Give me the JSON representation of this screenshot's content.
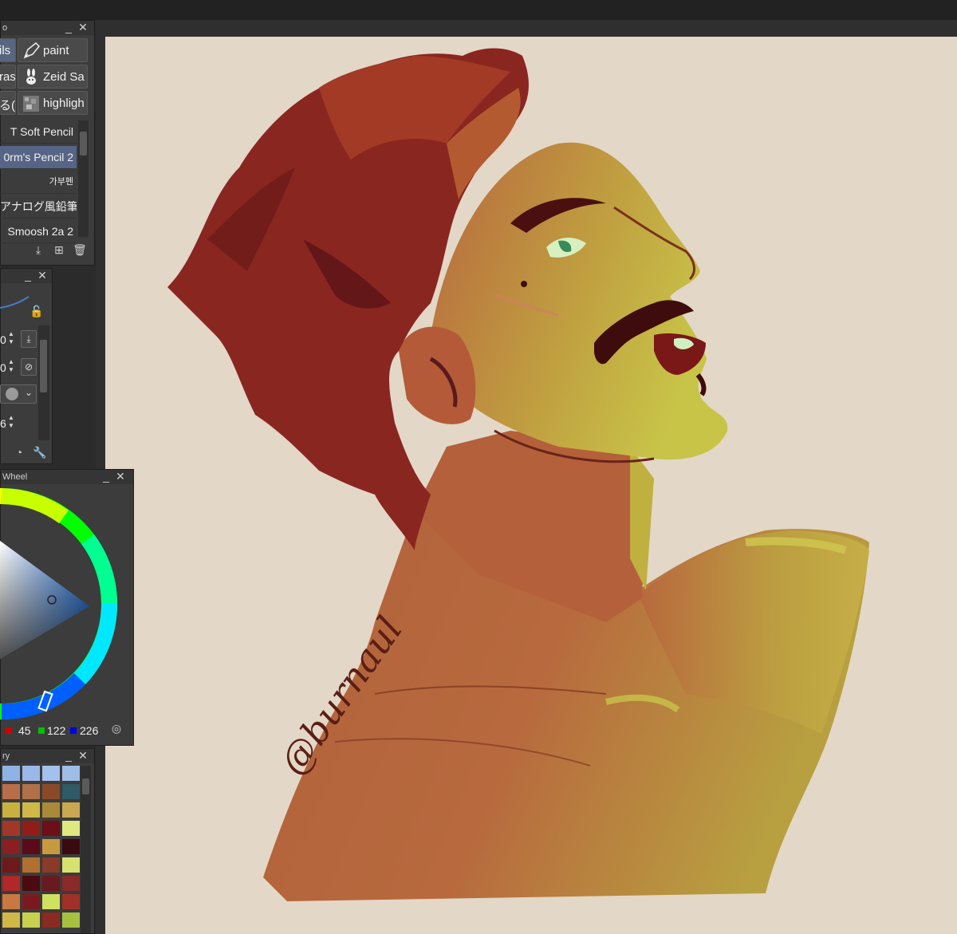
{
  "app": {
    "title_bar_color": "#222222",
    "canvas_color": "#e3d7c7"
  },
  "sub_tool_panel": {
    "title": "o",
    "tools": [
      {
        "label": "ils",
        "icon": "pencil-icon",
        "selected": true
      },
      {
        "label": "paint",
        "icon": "pen-nib-icon",
        "selected": false
      },
      {
        "label": "ras",
        "icon": "eraser-icon",
        "selected": false
      },
      {
        "label": "Zeid Sa",
        "icon": "rabbit-icon",
        "selected": false
      },
      {
        "label": "る(",
        "icon": "brush-icon",
        "selected": false
      },
      {
        "label": "highligh",
        "icon": "texture-icon",
        "selected": false
      }
    ],
    "brushes": [
      {
        "label": "T Soft Pencil",
        "selected": false
      },
      {
        "label": "0rm's Pencil 2",
        "selected": true
      },
      {
        "label": "가부펜",
        "selected": false
      },
      {
        "label": "アナログ風鉛筆³",
        "selected": false
      },
      {
        "label": "Smoosh 2a 2",
        "selected": false
      }
    ]
  },
  "tool_property_panel": {
    "size_value": "0",
    "opacity_value": "0",
    "density_value": "6"
  },
  "color_wheel_panel": {
    "title": "Wheel",
    "r": "45",
    "g": "122",
    "b": "226",
    "current_color": "#2d7ae2"
  },
  "color_history_panel": {
    "title": "ry",
    "colors": [
      [
        "#8eb4e6",
        "#9ab8e8",
        "#a4c0ec",
        "#9fbde8"
      ],
      [
        "#b86e4a",
        "#b07048",
        "#8a4a2a",
        "#2f5a66"
      ],
      [
        "#c8b040",
        "#d0b848",
        "#a88a38",
        "#c8a850"
      ],
      [
        "#a03828",
        "#901e18",
        "#6e0e18",
        "#e0e880"
      ],
      [
        "#8a1e20",
        "#5a0a18",
        "#c89a40",
        "#3a0a10"
      ],
      [
        "#6e1a1a",
        "#b07030",
        "#8a3a28",
        "#d8e070"
      ],
      [
        "#b02828",
        "#4a0a10",
        "#6a1a1e",
        "#8a2a2a"
      ],
      [
        "#c87840",
        "#7a1a20",
        "#d0e060",
        "#a03028"
      ],
      [
        "#d0b848",
        "#c8d050",
        "#8a2a20",
        "#a8c040"
      ]
    ]
  },
  "artwork": {
    "signature": "@burnaul"
  }
}
